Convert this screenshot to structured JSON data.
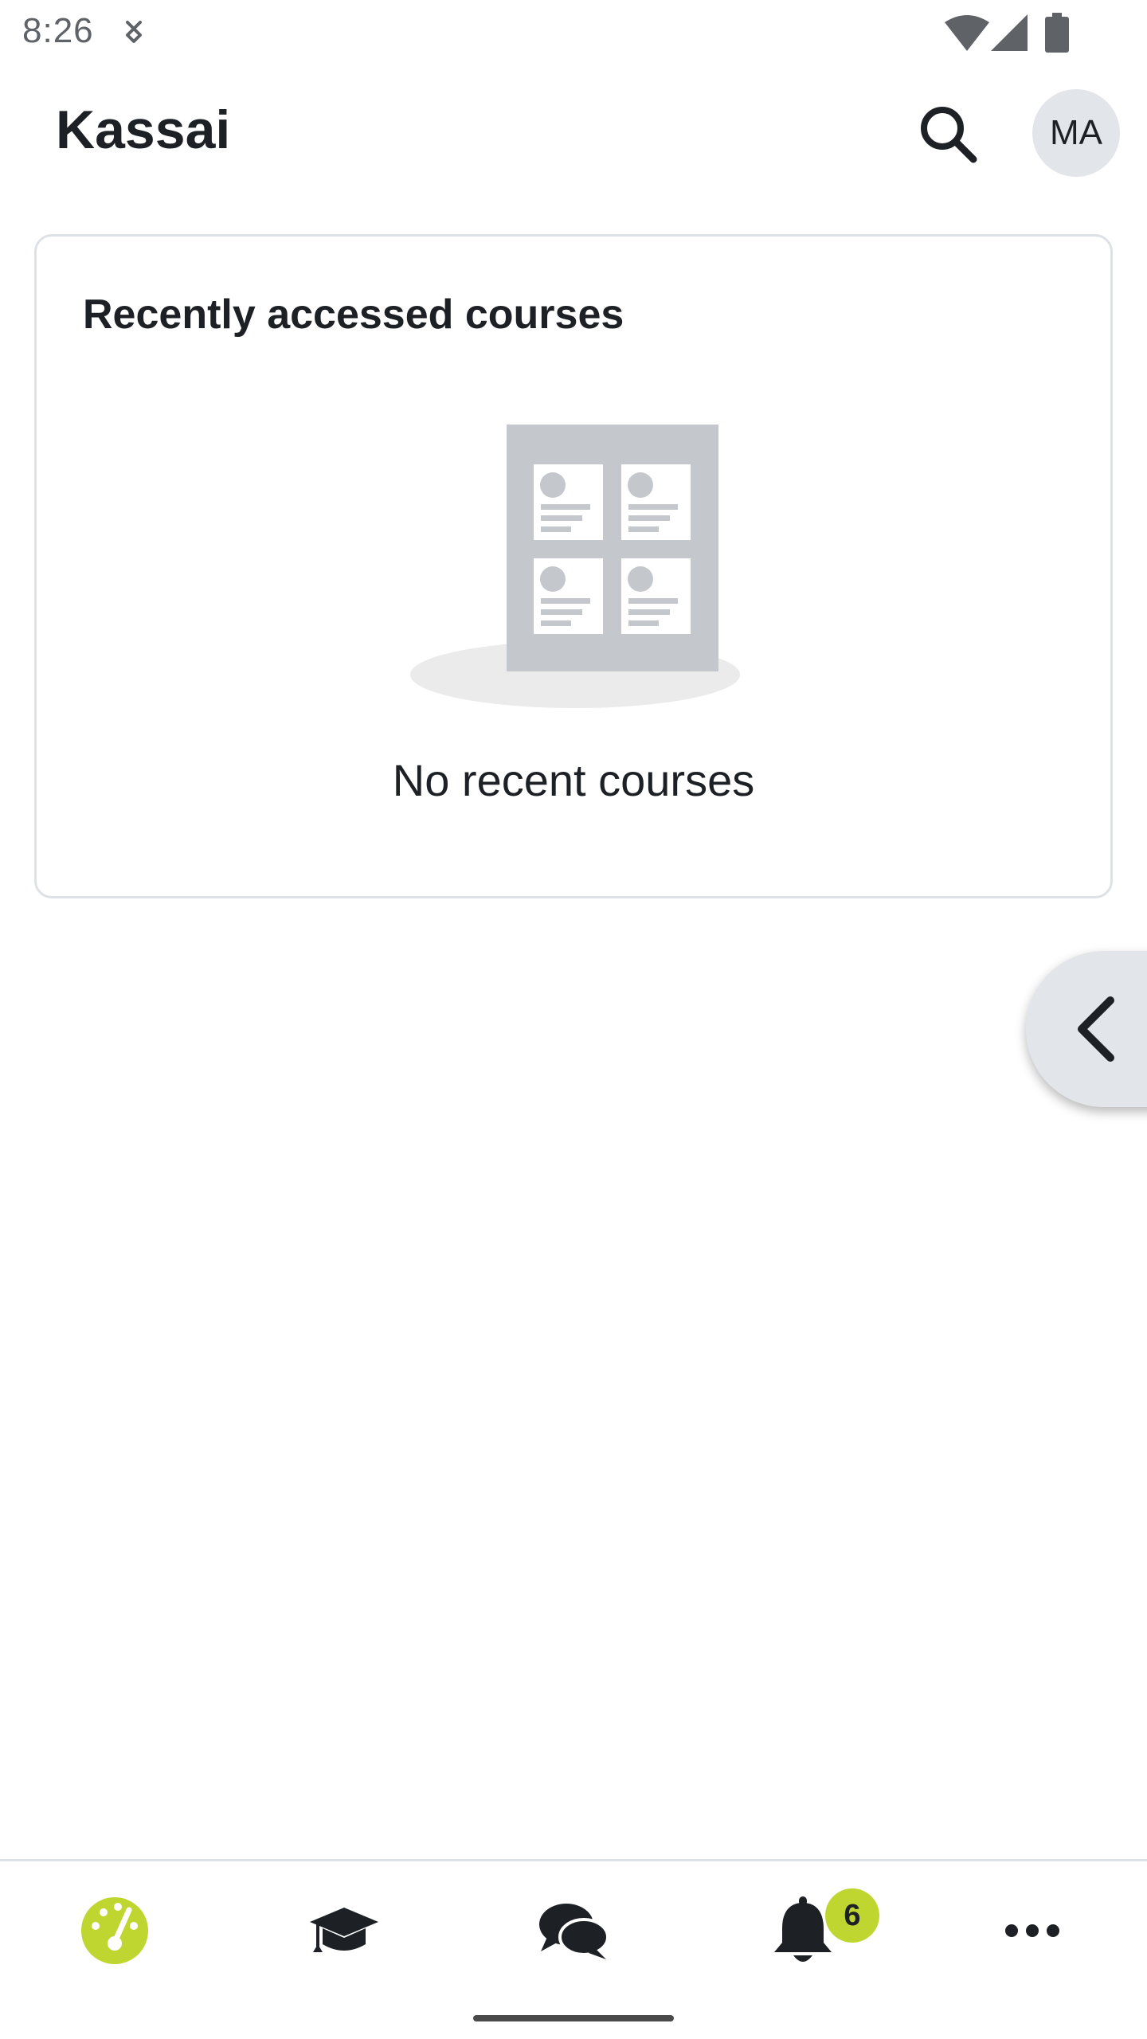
{
  "status_bar": {
    "time": "8:26",
    "icons": [
      "sync-icon",
      "wifi-icon",
      "signal-icon",
      "battery-icon"
    ]
  },
  "header": {
    "title": "Kassai",
    "search_icon": "search-icon",
    "avatar_initials": "MA"
  },
  "recent_courses": {
    "title": "Recently accessed courses",
    "empty_message": "No recent courses",
    "illustration": "course-grid-empty-icon"
  },
  "drawer_toggle": {
    "icon": "chevron-left-icon"
  },
  "bottom_nav": {
    "items": [
      {
        "id": "dashboard",
        "icon": "dashboard-icon",
        "active": true
      },
      {
        "id": "my-courses",
        "icon": "graduation-cap-icon",
        "active": false
      },
      {
        "id": "messages",
        "icon": "chat-bubbles-icon",
        "active": false
      },
      {
        "id": "notifications",
        "icon": "bell-icon",
        "active": false,
        "badge": "6"
      },
      {
        "id": "more",
        "icon": "more-horizontal-icon",
        "active": false
      }
    ]
  },
  "colors": {
    "accent": "#c0d630",
    "text": "#1d2125",
    "muted": "#5f6368",
    "avatar_bg": "#e2e5e9",
    "card_border": "#dee2e6",
    "illustration": "#c4c8cc"
  }
}
